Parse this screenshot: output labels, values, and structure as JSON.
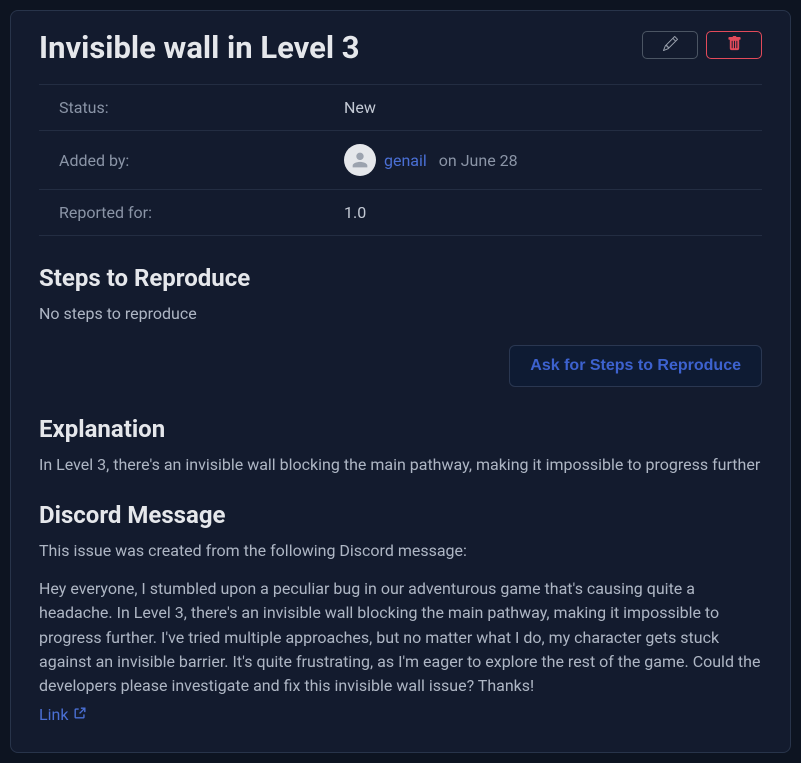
{
  "title": "Invisible wall in Level 3",
  "meta": {
    "status_label": "Status:",
    "status_value": "New",
    "added_by_label": "Added by:",
    "added_by_user": "genail",
    "added_by_date": "on June 28",
    "reported_for_label": "Reported for:",
    "reported_for_value": "1.0"
  },
  "steps": {
    "heading": "Steps to Reproduce",
    "empty_text": "No steps to reproduce",
    "ask_button": "Ask for Steps to Reproduce"
  },
  "explanation": {
    "heading": "Explanation",
    "text": "In Level 3, there's an invisible wall blocking the main pathway, making it impossible to progress further"
  },
  "discord": {
    "heading": "Discord Message",
    "intro": "This issue was created from the following Discord message:",
    "message": "Hey everyone, I stumbled upon a peculiar bug in our adventurous game that's causing quite a headache. In Level 3, there's an invisible wall blocking the main pathway, making it impossible to progress further. I've tried multiple approaches, but no matter what I do, my character gets stuck against an invisible barrier. It's quite frustrating, as I'm eager to explore the rest of the game. Could the developers please investigate and fix this invisible wall issue? Thanks!",
    "link_label": "Link"
  }
}
